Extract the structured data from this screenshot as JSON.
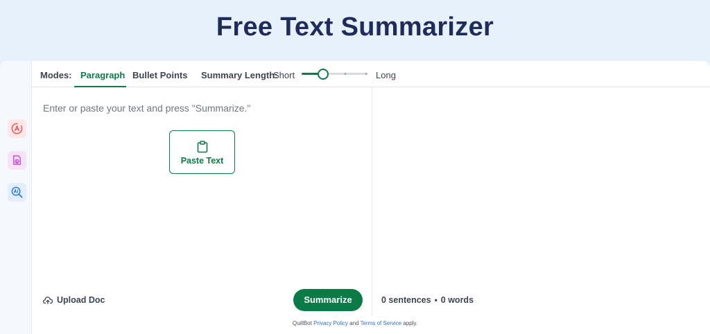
{
  "hero": {
    "title": "Free Text Summarizer"
  },
  "rail": {
    "items": [
      {
        "icon": "paraphrase-icon",
        "color": "#f2555a",
        "bg": "#fde7e7"
      },
      {
        "icon": "plagiarism-icon",
        "color": "#c84fcf",
        "bg": "#f6e3f7"
      },
      {
        "icon": "ai-detector-icon",
        "color": "#2e7fd6",
        "bg": "#e3eefb"
      }
    ]
  },
  "modes": {
    "label": "Modes:",
    "tabs": [
      {
        "label": "Paragraph",
        "active": true
      },
      {
        "label": "Bullet Points",
        "active": false
      }
    ]
  },
  "summary_length": {
    "label": "Summary Length:",
    "min_label": "Short",
    "max_label": "Long",
    "value": 0.32
  },
  "input": {
    "placeholder": "Enter or paste your text and press \"Summarize.\"",
    "paste_label": "Paste Text",
    "upload_label": "Upload Doc",
    "summarize_label": "Summarize"
  },
  "output": {
    "sentences": "0 sentences",
    "separator": "•",
    "words": "0 words"
  },
  "footer": {
    "prefix": "QuillBot",
    "privacy": "Privacy Policy",
    "and": "and",
    "terms": "Terms of Service",
    "suffix": "apply."
  },
  "colors": {
    "accent": "#0a7b46",
    "hero_bg": "#e7f1fc",
    "title": "#1f2c5a",
    "link": "#2f6fc4"
  }
}
